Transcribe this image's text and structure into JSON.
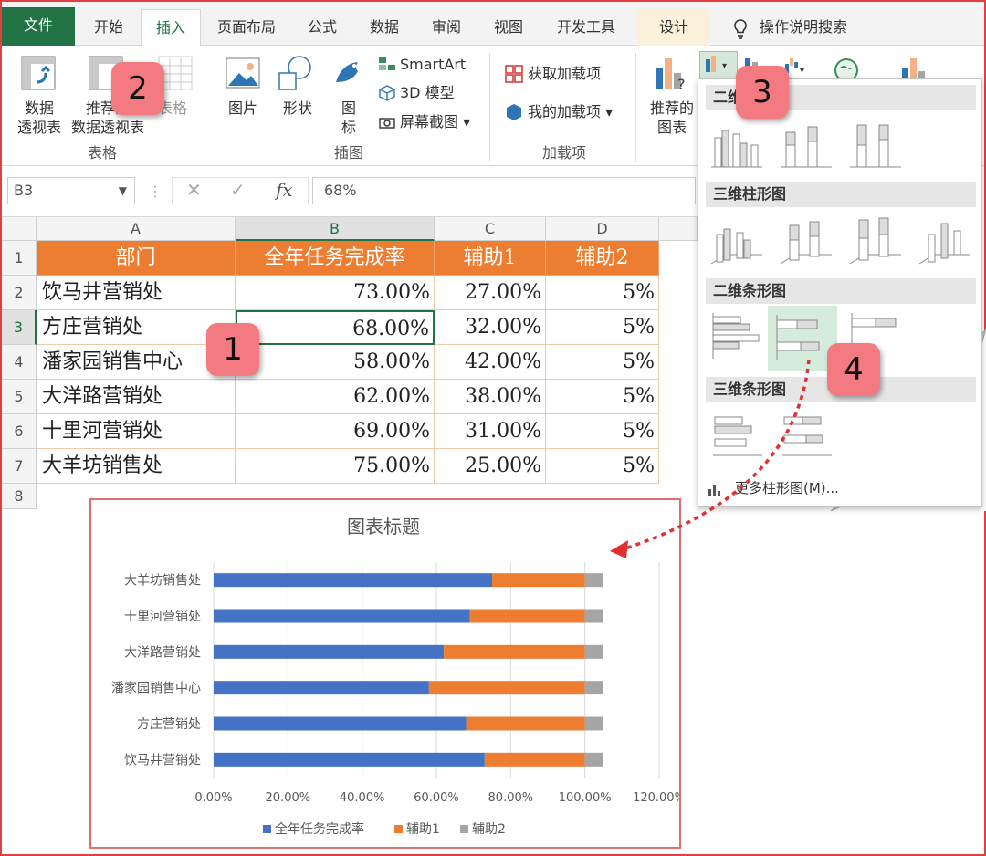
{
  "tabs": [
    "文件",
    "开始",
    "插入",
    "页面布局",
    "公式",
    "数据",
    "审阅",
    "视图",
    "开发工具",
    "设计",
    "操作说明搜索"
  ],
  "ribbon": {
    "tables_group": {
      "label": "表格",
      "buttons": [
        "数据\n透视表",
        "推荐的\n数据透视表",
        "表格"
      ]
    },
    "illustrations_group": {
      "label": "插图",
      "buttons": [
        "图片",
        "形状",
        "图\n标"
      ],
      "smartart": "SmartArt",
      "model3d": "3D 模型",
      "screenshot": "屏幕截图"
    },
    "addins_group": {
      "label": "加载项",
      "get": "获取加载项",
      "my": "我的加载项"
    },
    "recommended_charts": "推荐的\n图表"
  },
  "formula_bar": {
    "cell_ref": "B3",
    "value": "68%"
  },
  "sheet": {
    "columns": [
      "A",
      "B",
      "C",
      "D"
    ],
    "rows": [
      "1",
      "2",
      "3",
      "4",
      "5",
      "6",
      "7",
      "8"
    ],
    "header": [
      "部门",
      "全年任务完成率",
      "辅助1",
      "辅助2"
    ],
    "data": [
      [
        "饮马井营销处",
        "73.00%",
        "27.00%",
        "5%"
      ],
      [
        "方庄营销处",
        "68.00%",
        "32.00%",
        "5%"
      ],
      [
        "潘家园销售中心",
        "58.00%",
        "42.00%",
        "5%"
      ],
      [
        "大洋路营销处",
        "62.00%",
        "38.00%",
        "5%"
      ],
      [
        "十里河营销处",
        "69.00%",
        "31.00%",
        "5%"
      ],
      [
        "大羊坊销售处",
        "75.00%",
        "25.00%",
        "5%"
      ]
    ]
  },
  "dropdown": {
    "sections": [
      "二维",
      "三维柱形图",
      "二维条形图",
      "三维条形图"
    ],
    "more": "更多柱形图(M)..."
  },
  "badges": [
    "1",
    "2",
    "3",
    "4"
  ],
  "chart_data": {
    "type": "bar",
    "orientation": "horizontal",
    "stacked": true,
    "title": "图表标题",
    "categories": [
      "饮马井营销处",
      "方庄营销处",
      "潘家园销售中心",
      "大洋路营销处",
      "十里河营销处",
      "大羊坊销售处"
    ],
    "series": [
      {
        "name": "全年任务完成率",
        "values": [
          0.73,
          0.68,
          0.58,
          0.62,
          0.69,
          0.75
        ],
        "color": "#4472c4"
      },
      {
        "name": "辅助1",
        "values": [
          0.27,
          0.32,
          0.42,
          0.38,
          0.31,
          0.25
        ],
        "color": "#ed7d31"
      },
      {
        "name": "辅助2",
        "values": [
          0.05,
          0.05,
          0.05,
          0.05,
          0.05,
          0.05
        ],
        "color": "#a5a5a5"
      }
    ],
    "xlim": [
      0,
      1.2
    ],
    "ticks": [
      "0.00%",
      "20.00%",
      "40.00%",
      "60.00%",
      "80.00%",
      "100.00%",
      "120.00%"
    ],
    "legend": "bottom",
    "grid": true
  }
}
